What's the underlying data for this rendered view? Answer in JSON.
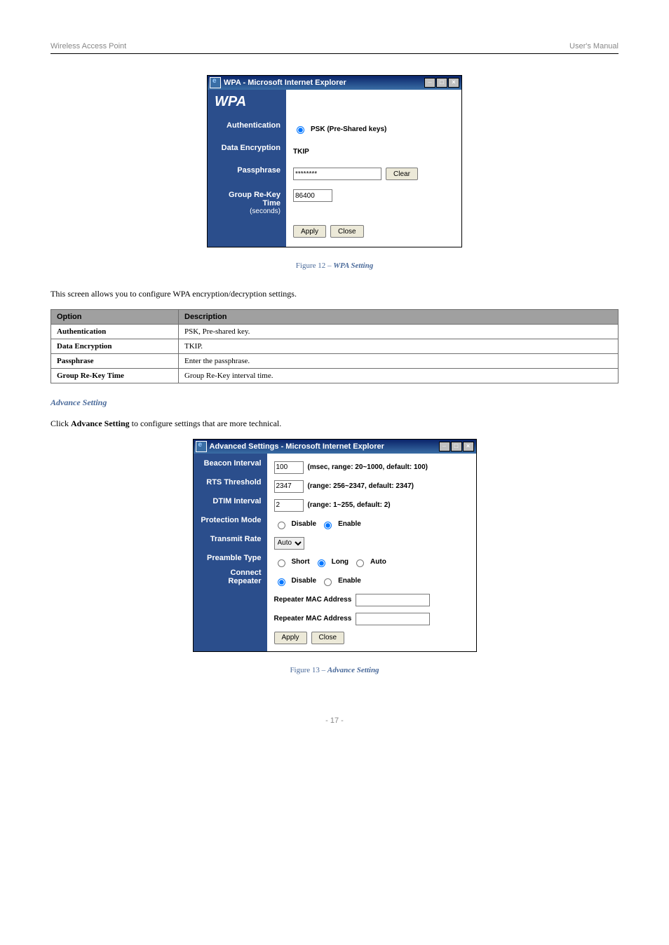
{
  "page_header": {
    "left": "Wireless Access Point",
    "right": "User's Manual"
  },
  "wpa_window": {
    "title": "WPA - Microsoft Internet Explorer",
    "heading": "WPA",
    "rows": {
      "auth": {
        "label": "Authentication",
        "option": "PSK (Pre-Shared keys)"
      },
      "enc": {
        "label": "Data Encryption",
        "value": "TKIP"
      },
      "pass": {
        "label": "Passphrase",
        "value": "********",
        "clear": "Clear"
      },
      "rekey": {
        "label": "Group Re-Key Time",
        "sub": "(seconds)",
        "value": "86400"
      }
    },
    "buttons": {
      "apply": "Apply",
      "close": "Close"
    }
  },
  "wpa_caption": {
    "prefix": "Figure 12 – ",
    "title": "WPA Setting"
  },
  "wpa_intro": "This screen allows you to configure WPA encryption/decryption settings.",
  "wpa_table": {
    "header": {
      "option": "Option",
      "desc": "Description"
    },
    "rows": [
      {
        "option": "Authentication",
        "desc": "PSK, Pre-shared key."
      },
      {
        "option": "Data Encryption",
        "desc": "TKIP."
      },
      {
        "option": "Passphrase",
        "desc": "Enter the passphrase."
      },
      {
        "option": "Group Re-Key Time",
        "desc": "Group Re-Key interval time."
      }
    ]
  },
  "adv_heading": "Advance Setting",
  "adv_intro": {
    "pre": "Click ",
    "bold": "Advance Setting",
    "post": " to configure settings that are more technical."
  },
  "adv_window": {
    "title": "Advanced Settings - Microsoft Internet Explorer",
    "rows": {
      "beacon": {
        "label": "Beacon Interval",
        "value": "100",
        "note": "(msec, range: 20~1000, default: 100)"
      },
      "rts": {
        "label": "RTS Threshold",
        "value": "2347",
        "note": "(range: 256~2347, default: 2347)"
      },
      "dtim": {
        "label": "DTIM Interval",
        "value": "2",
        "note": "(range: 1~255, default: 2)"
      },
      "prot": {
        "label": "Protection Mode",
        "disable": "Disable",
        "enable": "Enable"
      },
      "tx": {
        "label": "Transmit Rate",
        "value": "Auto"
      },
      "preamble": {
        "label": "Preamble Type",
        "short": "Short",
        "long": "Long",
        "auto": "Auto"
      },
      "repeater": {
        "label": "Connect Repeater",
        "disable": "Disable",
        "enable": "Enable"
      },
      "mac1": {
        "label": "Repeater MAC Address"
      },
      "mac2": {
        "label": "Repeater MAC Address"
      }
    },
    "buttons": {
      "apply": "Apply",
      "close": "Close"
    }
  },
  "adv_caption": {
    "prefix": "Figure 13 – ",
    "title": "Advance Setting"
  },
  "page_footer": "- 17 -"
}
